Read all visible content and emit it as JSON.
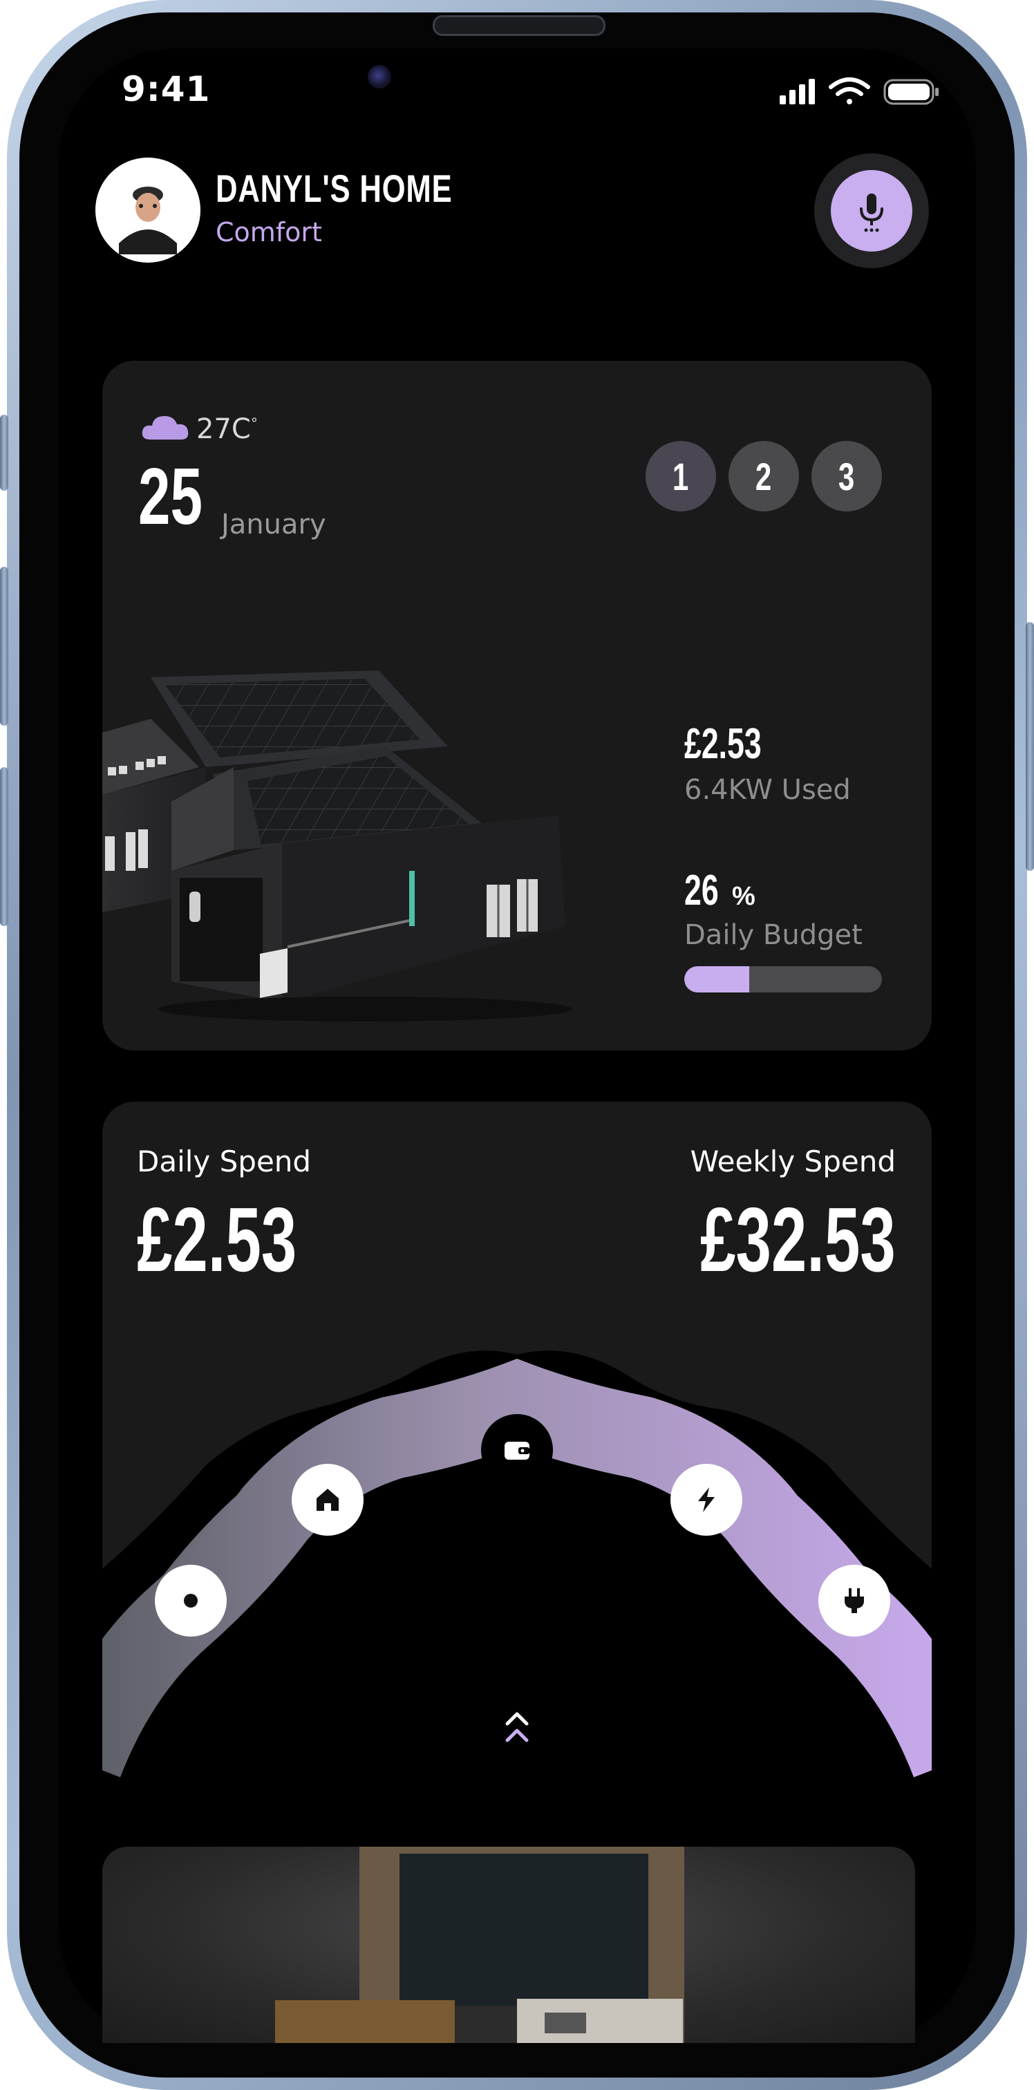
{
  "status_bar": {
    "time": "9:41"
  },
  "header": {
    "title": "DANYL'S HOME",
    "subtitle": "Comfort"
  },
  "weather": {
    "temperature": "27C",
    "temp_unit_mark": "°",
    "day": "25",
    "month": "January"
  },
  "steps": [
    "1",
    "2",
    "3"
  ],
  "usage": {
    "cost": "£2.53",
    "used_label": "6.4KW Used",
    "budget_value": "26",
    "budget_unit": "%",
    "budget_label": "Daily Budget",
    "budget_fraction": 0.33
  },
  "spend": {
    "daily_label": "Daily Spend",
    "daily_value": "£2.53",
    "weekly_label": "Weekly Spend",
    "weekly_value": "£32.53"
  },
  "categories": [
    {
      "icon": "record-icon"
    },
    {
      "icon": "home-icon"
    },
    {
      "icon": "wallet-icon"
    },
    {
      "icon": "lightning-icon"
    },
    {
      "icon": "plug-icon"
    }
  ],
  "colors": {
    "accent": "#c9aef0",
    "card": "#1a1a1b",
    "background": "#000000"
  }
}
